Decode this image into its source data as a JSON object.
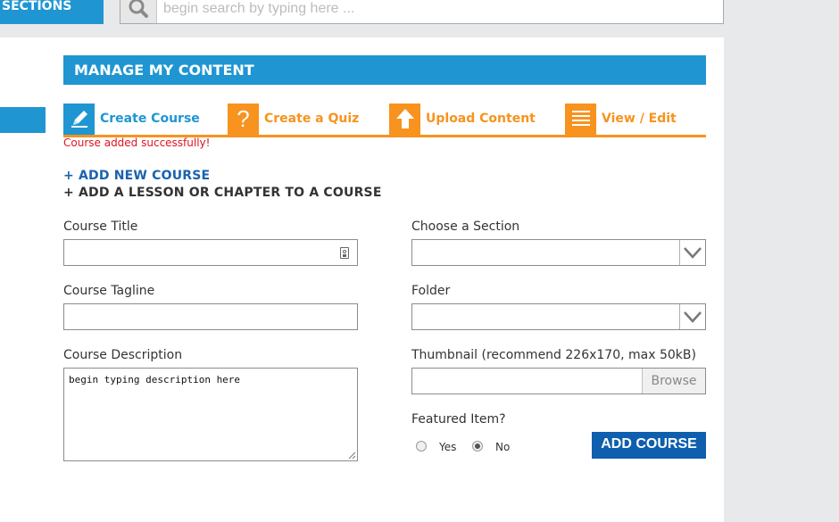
{
  "topbar": {
    "sections_label": "SECTIONS",
    "search_placeholder": "begin search by typing here ..."
  },
  "header": {
    "title": "MANAGE MY CONTENT"
  },
  "tabs": [
    {
      "label": "Create Course",
      "icon": "pencil-icon",
      "color": "#1f96d2"
    },
    {
      "label": "Create a Quiz",
      "icon": "question-icon",
      "color": "#f7931e"
    },
    {
      "label": "Upload Content",
      "icon": "upload-arrow-icon",
      "color": "#f7931e"
    },
    {
      "label": "View / Edit",
      "icon": "list-icon",
      "color": "#f7931e"
    }
  ],
  "status_message": "Course added successfully!",
  "links": {
    "add_new_course": "+ ADD NEW COURSE",
    "add_lesson": "+ ADD A LESSON OR CHAPTER TO A COURSE"
  },
  "form": {
    "course_title_label": "Course Title",
    "course_title_value": "",
    "course_tagline_label": "Course Tagline",
    "course_tagline_value": "",
    "course_description_label": "Course Description",
    "course_description_value": "begin typing description here",
    "choose_section_label": "Choose a Section",
    "choose_section_value": "",
    "folder_label": "Folder",
    "folder_value": "",
    "thumbnail_label": "Thumbnail (recommend 226x170, max 50kB)",
    "browse_label": "Browse",
    "featured_label": "Featured Item?",
    "featured_options": [
      "Yes",
      "No"
    ],
    "featured_selected": "No",
    "submit_label": "ADD COURSE"
  },
  "colors": {
    "accent_blue": "#1f96d2",
    "accent_orange": "#f7931e",
    "button_blue": "#0f5fae",
    "status_red": "#e0141e"
  }
}
